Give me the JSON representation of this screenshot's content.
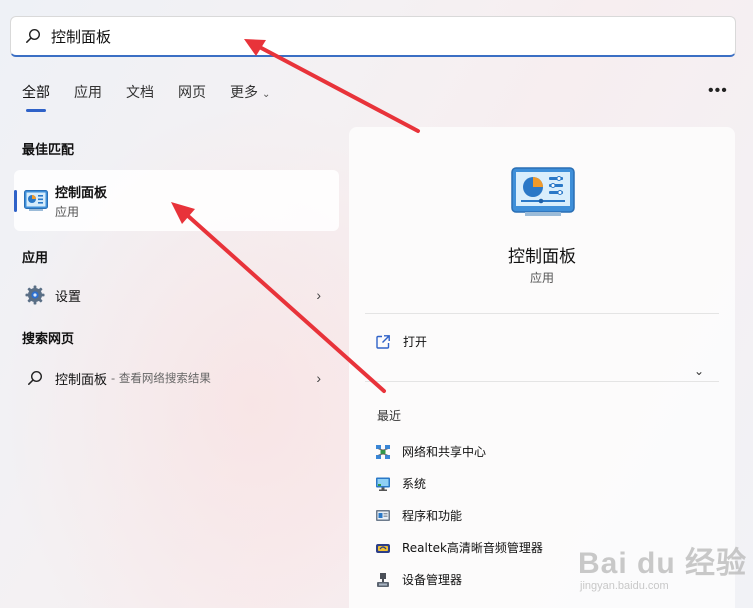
{
  "search": {
    "value": "控制面板"
  },
  "tabs": [
    {
      "label": "全部"
    },
    {
      "label": "应用"
    },
    {
      "label": "文档"
    },
    {
      "label": "网页"
    },
    {
      "label": "更多"
    }
  ],
  "sections": {
    "best_match": "最佳匹配",
    "apps": "应用",
    "web": "搜索网页"
  },
  "best_match": {
    "name": "控制面板",
    "type": "应用"
  },
  "apps": [
    {
      "label": "设置"
    }
  ],
  "web_results": [
    {
      "label": "控制面板",
      "hint": "- 查看网络搜索结果"
    }
  ],
  "detail": {
    "title": "控制面板",
    "type": "应用",
    "open_label": "打开",
    "recent_title": "最近",
    "recent": [
      {
        "label": "网络和共享中心",
        "icon": "network-icon"
      },
      {
        "label": "系统",
        "icon": "monitor-icon"
      },
      {
        "label": "程序和功能",
        "icon": "programs-icon"
      },
      {
        "label": "Realtek高清晰音频管理器",
        "icon": "audio-manager-icon"
      },
      {
        "label": "设备管理器",
        "icon": "device-manager-icon"
      }
    ]
  },
  "watermark": {
    "brand": "Bai du 经验",
    "url": "jingyan.baidu.com"
  },
  "colors": {
    "accent": "#2f62c8",
    "annotation_arrow": "#e8333a"
  }
}
